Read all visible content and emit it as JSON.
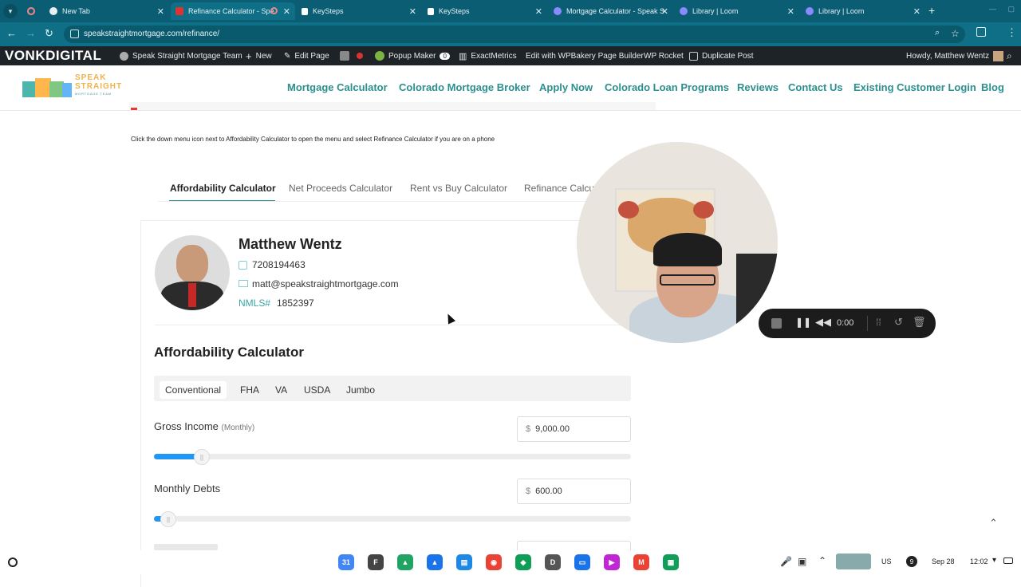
{
  "browser": {
    "tabs": [
      {
        "label": "New Tab",
        "color": "#e9eef2"
      },
      {
        "label": "Refinance Calculator - Spe",
        "color": "#d33"
      },
      {
        "label": "KeySteps",
        "color": "#fff"
      },
      {
        "label": "KeySteps",
        "color": "#fff"
      },
      {
        "label": "Mortgage Calculator - Speak S",
        "color": "#6b6bff"
      },
      {
        "label": "Library | Loom",
        "color": "#6b6bff"
      },
      {
        "label": "Library | Loom",
        "color": "#6b6bff"
      }
    ],
    "new_tab": "+",
    "url": "speakstraightmortgage.com/refinance/"
  },
  "wpbar": {
    "brand": "VONKDIGITAL",
    "site": "Speak Straight Mortgage Team",
    "new": "New",
    "edit": "Edit Page",
    "popup": "Popup Maker",
    "popup_count": "0",
    "exactmetrics": "ExactMetrics",
    "wpbakery": "Edit with WPBakery Page Builder",
    "rocket": "WP Rocket",
    "duplicate": "Duplicate Post",
    "howdy": "Howdy, Matthew Wentz"
  },
  "site": {
    "logo_line1": "SPEAK",
    "logo_line2": "STRAIGHT",
    "logo_line3": "MORTGAGE TEAM",
    "nav": [
      "Mortgage Calculator",
      "Colorado Mortgage Broker",
      "Apply Now",
      "Colorado Loan Programs",
      "Reviews",
      "Contact Us",
      "Existing Customer Login",
      "Blog"
    ]
  },
  "content": {
    "instruction": "Click the down menu icon next to Affordability Calculator to open the menu and select Refinance Calculator if you are on a phone",
    "calc_tabs": [
      "Affordability Calculator",
      "Net Proceeds Calculator",
      "Rent vs Buy Calculator",
      "Refinance Calcu"
    ],
    "agent": {
      "name": "Matthew Wentz",
      "phone": "7208194463",
      "email": "matt@speakstraightmortgage.com",
      "nmls_label": "NMLS#",
      "nmls": "1852397"
    },
    "calc_title": "Affordability Calculator",
    "loan_types": [
      "Conventional",
      "FHA",
      "VA",
      "USDA",
      "Jumbo"
    ],
    "gross_income_label": "Gross Income",
    "gross_income_sub": "(Monthly)",
    "gross_income_value": "9,000.00",
    "gross_income_level": 0.09,
    "debts_label": "Monthly Debts",
    "debts_value": "600.00",
    "debts_level": 0.02,
    "currency": "$"
  },
  "recorder": {
    "time": "0:00"
  },
  "taskbar": {
    "lang": "US",
    "date": "Sep 28",
    "time": "12:02",
    "apps": [
      {
        "label": "31",
        "color": "#4285f4"
      },
      {
        "label": "F",
        "color": "#444"
      },
      {
        "label": "▲",
        "color": "#1fa463"
      },
      {
        "label": "▲",
        "color": "#1a73e8"
      },
      {
        "label": "▤",
        "color": "#1e88e5"
      },
      {
        "label": "◉",
        "color": "#ea4335"
      },
      {
        "label": "◆",
        "color": "#0f9d58"
      },
      {
        "label": "D",
        "color": "#555"
      },
      {
        "label": "▭",
        "color": "#1a73e8"
      },
      {
        "label": "▶",
        "color": "#c026d3"
      },
      {
        "label": "M",
        "color": "#ea4335"
      },
      {
        "label": "▦",
        "color": "#0f9d58"
      }
    ]
  }
}
